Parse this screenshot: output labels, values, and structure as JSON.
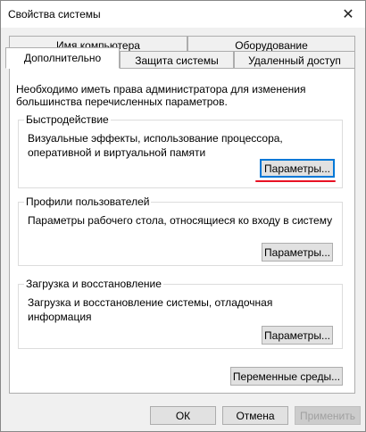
{
  "window": {
    "title": "Свойства системы",
    "close_icon": "close-icon"
  },
  "tabs": {
    "row1": [
      "Имя компьютера",
      "Оборудование"
    ],
    "row2": [
      "Дополнительно",
      "Защита системы",
      "Удаленный доступ"
    ],
    "active": "Дополнительно"
  },
  "intro_text": "Необходимо иметь права администратора для изменения большинства перечисленных параметров.",
  "groups": {
    "performance": {
      "title": "Быстродействие",
      "text": "Визуальные эффекты, использование процессора, оперативной и виртуальной памяти",
      "button": "Параметры..."
    },
    "profiles": {
      "title": "Профили пользователей",
      "text": "Параметры рабочего стола, относящиеся ко входу в систему",
      "button": "Параметры..."
    },
    "startup": {
      "title": "Загрузка и восстановление",
      "text": "Загрузка и восстановление системы, отладочная информация",
      "button": "Параметры..."
    }
  },
  "env_button": "Переменные среды...",
  "footer": {
    "ok": "ОК",
    "cancel": "Отмена",
    "apply": "Применить"
  },
  "colors": {
    "highlight": "#e81123",
    "accent": "#0078d7"
  }
}
